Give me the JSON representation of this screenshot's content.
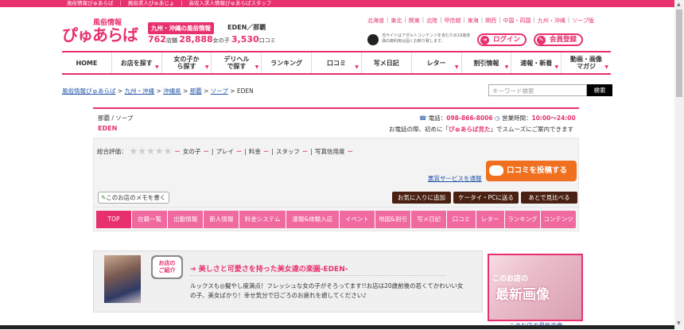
{
  "topbar": {
    "links": [
      "風俗情報ぴゅあらば",
      "風俗求人ぴゅあじょ",
      "高収入求人情報ぴゅあらばスタッフ"
    ]
  },
  "header": {
    "logo_small": "風俗情報",
    "logo_main": "ぴゅあらば",
    "region_badge": "九州・沖縄の風俗情報",
    "region_text": "EDEN／那覇",
    "stats": {
      "shops_num": "762",
      "shops_unit": "店舗",
      "girls_num": "28,888",
      "girls_unit": "女の子",
      "reviews_num": "3,530",
      "reviews_unit": "口コミ"
    },
    "areas": [
      "北海道",
      "東北",
      "関東",
      "北陸",
      "甲信越",
      "東海",
      "関西",
      "中国・四国",
      "九州・沖縄",
      "ソープ版"
    ],
    "adult_notice": "当サイトはアダルトコンテンツを含むため18歳未満の御利用は固くお断り致します。",
    "login_label": "ログイン",
    "register_label": "会員登録"
  },
  "nav": [
    {
      "label": "HOME"
    },
    {
      "label": "お店を探す"
    },
    {
      "label": "女の子から探す"
    },
    {
      "label": "デリヘルで探す"
    },
    {
      "label": "ランキング"
    },
    {
      "label": "口コミ"
    },
    {
      "label": "写メ日記"
    },
    {
      "label": "レター"
    },
    {
      "label": "割引情報"
    },
    {
      "label": "速報・新着"
    },
    {
      "label": "動画・画像マガジ"
    }
  ],
  "breadcrumb": [
    "風俗情報ぴゅあらば",
    "九州・沖縄",
    "沖縄県",
    "那覇",
    "ソープ",
    "EDEN"
  ],
  "search": {
    "placeholder": "キーワード検索",
    "button": "検索"
  },
  "shop": {
    "category": "那覇 / ソープ",
    "name": "EDEN",
    "tel_label": "電話：",
    "tel": "098-866-8006",
    "hours_label": "営業時間：",
    "hours": "10:00～24:00",
    "note_pre": "お電話の際、初めに「",
    "note_key": "ぴゅあらば見た",
    "note_post": "」でスムーズにご案内できます"
  },
  "rating": {
    "label": "総合評価：",
    "stars": 0,
    "items": [
      "女の子",
      "プレイ",
      "料金",
      "スタッフ",
      "写真信用度"
    ],
    "dash": "－",
    "post_button": "口コミを投稿する",
    "report_link": "悪質サービスを通報",
    "memo_button": "このお店のメモを書く",
    "actions": [
      "お気に入りに追加",
      "ケータイ・PCに送る",
      "あとで見比べる"
    ]
  },
  "tabs": [
    "TOP",
    "在籍一覧",
    "出勤情報",
    "新人情報",
    "料金システム",
    "速報&体験入店",
    "イベント",
    "地図&割引",
    "写メ日記",
    "口コミ",
    "レター",
    "ランキング",
    "コンテンツ"
  ],
  "intro": {
    "badge_line1": "お店の",
    "badge_line2": "ご紹介",
    "title": "美しさと可愛さを持った美女達の楽園-EDEN-",
    "text": "ルックスも◎擬やし度満点！フレッシュな女の子がそろってます!!お店は20歳前後の若くてかわいい女の子、美女ばかり！幸せ気分で日ごろのお疲れを癒してください♪"
  },
  "latest": {
    "small": "このお店の",
    "big": "最新画像",
    "label": "このお店の最新画像"
  },
  "colors": {
    "brand": "#e8306e",
    "tab": "#f06aa0",
    "button_orange": "#f07020",
    "button_dark": "#4a2012"
  }
}
